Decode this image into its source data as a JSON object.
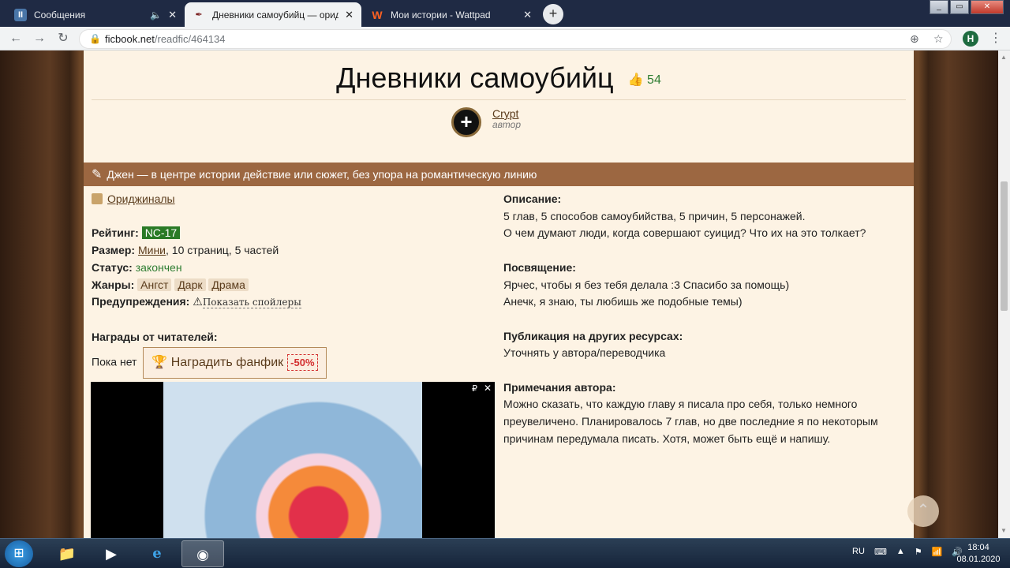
{
  "browser": {
    "tabs": [
      {
        "title": "Сообщения",
        "favicon": "II",
        "favicon_color": "#4a76a8",
        "active": false
      },
      {
        "title": "Дневники самоубийц — ориджинал",
        "favicon": "✒",
        "favicon_color": "#7a1f1f",
        "active": true
      },
      {
        "title": "Мои истории - Wattpad",
        "favicon": "W",
        "favicon_color": "#ff6122",
        "active": false
      }
    ],
    "url_host": "ficbook.net",
    "url_path": "/readfic/464134",
    "profile_initial": "H"
  },
  "story": {
    "title": "Дневники самоубийц",
    "likes": "54",
    "author_name": "Crypt",
    "author_role": "автор",
    "direction_text": "Джен — в центре истории действие или сюжет, без упора на романтическую линию",
    "fandom": "Ориджиналы",
    "rating_label": "Рейтинг:",
    "rating_value": "NC-17",
    "size_label": "Размер:",
    "size_link": "Мини",
    "size_rest": ", 10 страниц, 5 частей",
    "status_label": "Статус:",
    "status_value": "закончен",
    "genres_label": "Жанры:",
    "genres": [
      "Ангст",
      "Дарк",
      "Драма"
    ],
    "warnings_label": "Предупреждения:",
    "warnings_link": "Показать спойлеры",
    "awards_label": "Награды от читателей:",
    "awards_none": "Пока нет",
    "award_button": "Наградить фанфик",
    "award_sale": "-50%",
    "description_label": "Описание:",
    "description_lines": [
      "5 глав, 5 способов самоубийства, 5 причин, 5 персонажей.",
      "О чем думают люди, когда совершают суицид? Что их на это толкает?"
    ],
    "dedication_label": "Посвящение:",
    "dedication_lines": [
      "Ярчес, чтобы я без тебя делала :3 Спасибо за помощь)",
      "Анечк, я знаю, ты любишь же подобные темы)"
    ],
    "publication_label": "Публикация на других ресурсах:",
    "publication_text": "Уточнять у автора/переводчика",
    "notes_label": "Примечания автора:",
    "notes_lines": [
      "Можно сказать, что каждую главу я писала про себя, только немного",
      "преувеличено. Планировалось 7 глав, но две последние я по некоторым",
      "причинам передумала писать. Хотя, может быть ещё и напишу."
    ]
  },
  "ad": {
    "mark": "₽",
    "close": "✕"
  },
  "taskbar": {
    "lang": "RU",
    "time": "18:04",
    "date": "08.01.2020"
  },
  "colors": {
    "accent": "#9c6741",
    "rating": "#2a7a26",
    "status": "#2e7d32"
  }
}
